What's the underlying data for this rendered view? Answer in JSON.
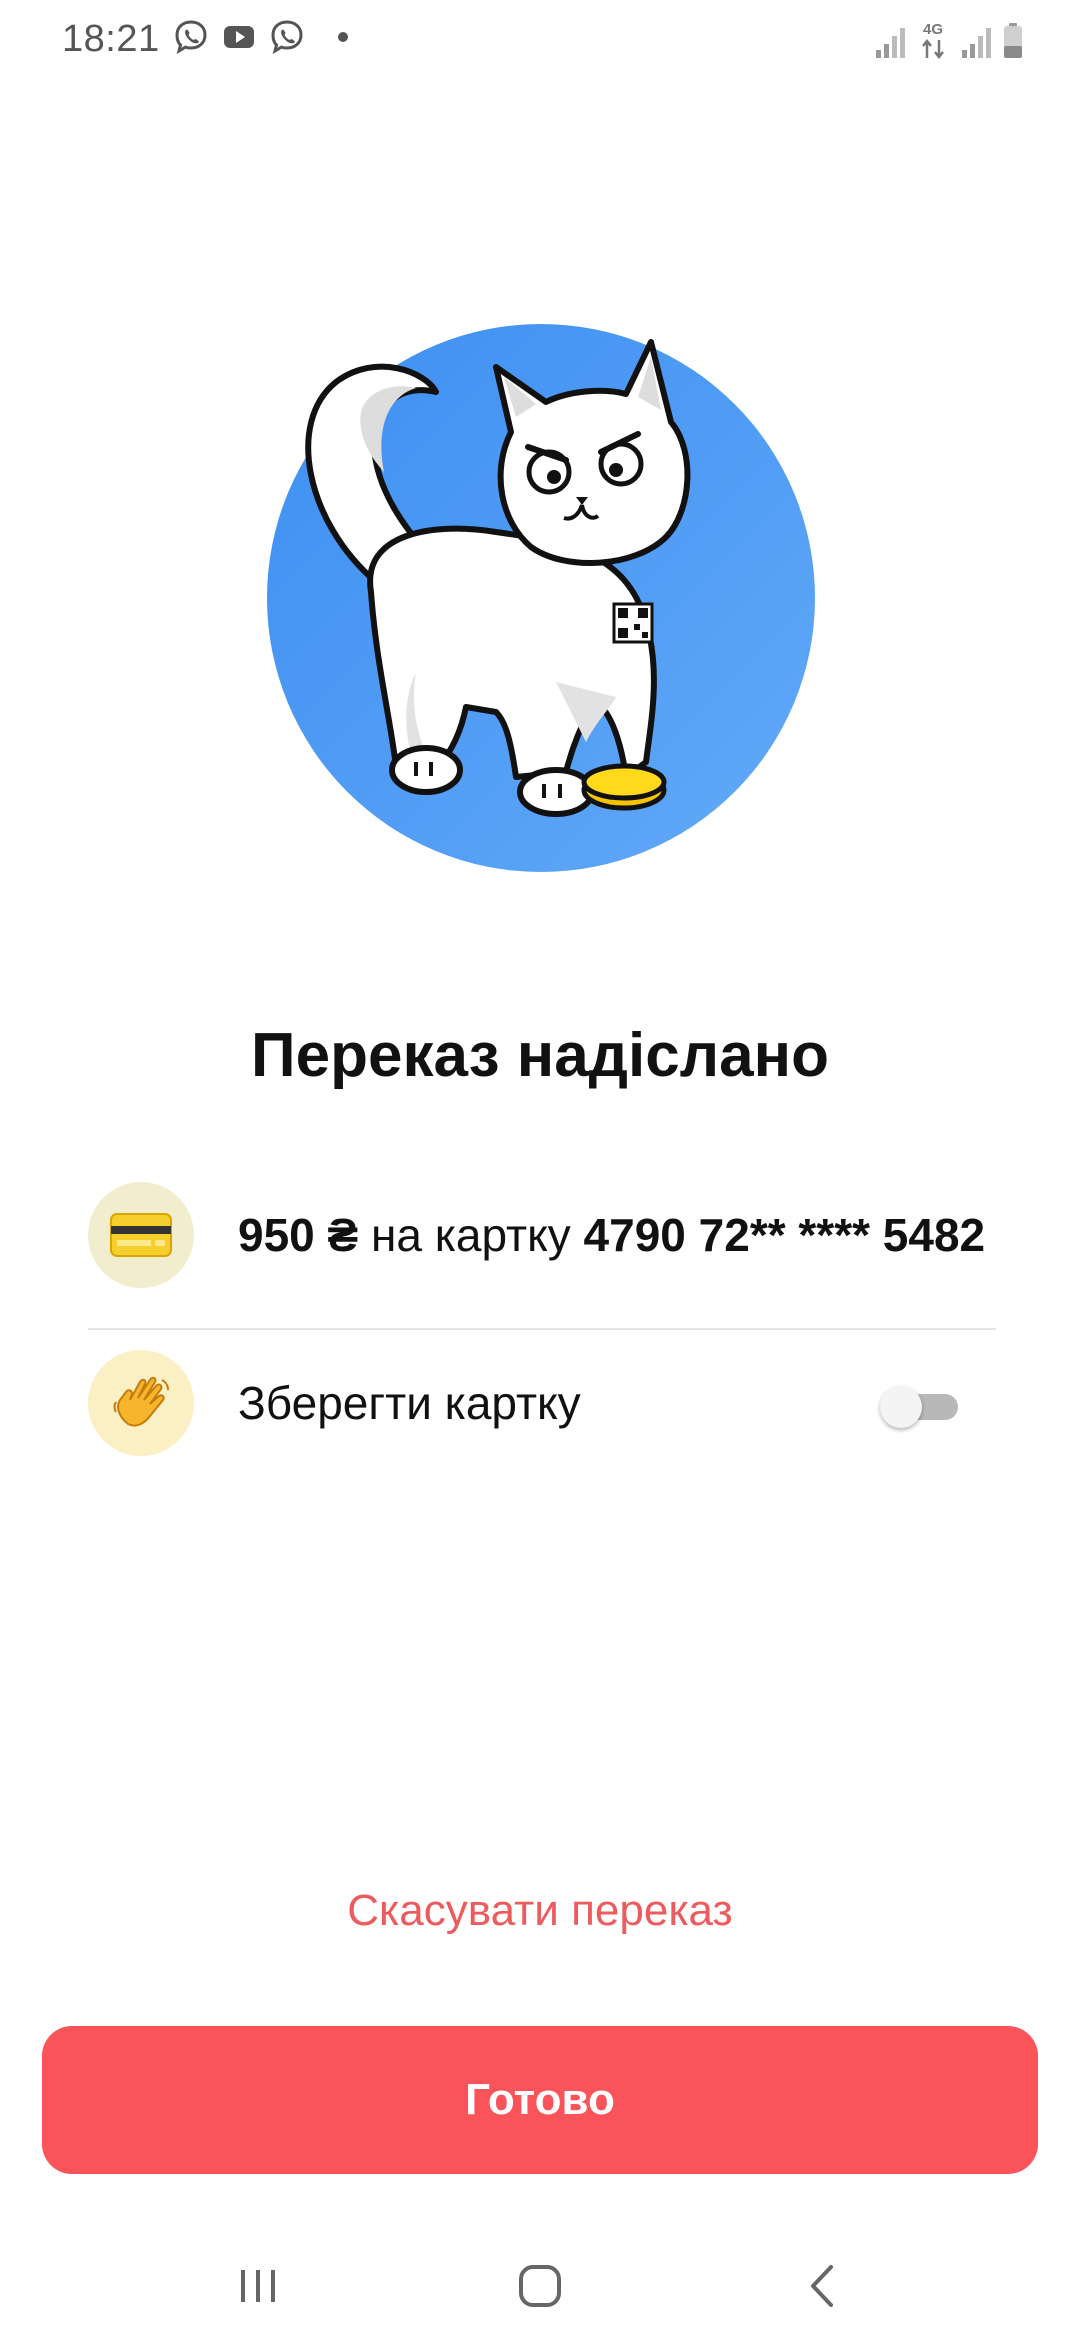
{
  "status_bar": {
    "time": "18:21",
    "network_label": "4G",
    "left_icons": [
      "viber-icon",
      "youtube-icon",
      "viber-icon",
      "dot"
    ],
    "right_icons": [
      "signal-icon",
      "4g-data-icon",
      "signal-icon",
      "battery-icon"
    ]
  },
  "hero": {
    "illustration": "cat-with-coin-illustration",
    "circle_color": "#4a9af5"
  },
  "title": "Переказ надіслано",
  "transfer": {
    "amount": "950 ₴",
    "middle": " на картку ",
    "card_number": "4790 72** **** 5482",
    "icon": "credit-card-icon"
  },
  "save_card": {
    "label": "Зберегти картку",
    "icon": "waving-hand-icon",
    "toggle_on": false
  },
  "actions": {
    "cancel_label": "Скасувати переказ",
    "done_label": "Готово"
  },
  "colors": {
    "accent": "#fa5359",
    "cancel_text": "#ee5b5f",
    "card_badge_bg": "#f3edcf",
    "hand_badge_bg": "#fbefc4"
  },
  "nav_bar": {
    "buttons": [
      "recents-icon",
      "home-icon",
      "back-icon"
    ]
  }
}
